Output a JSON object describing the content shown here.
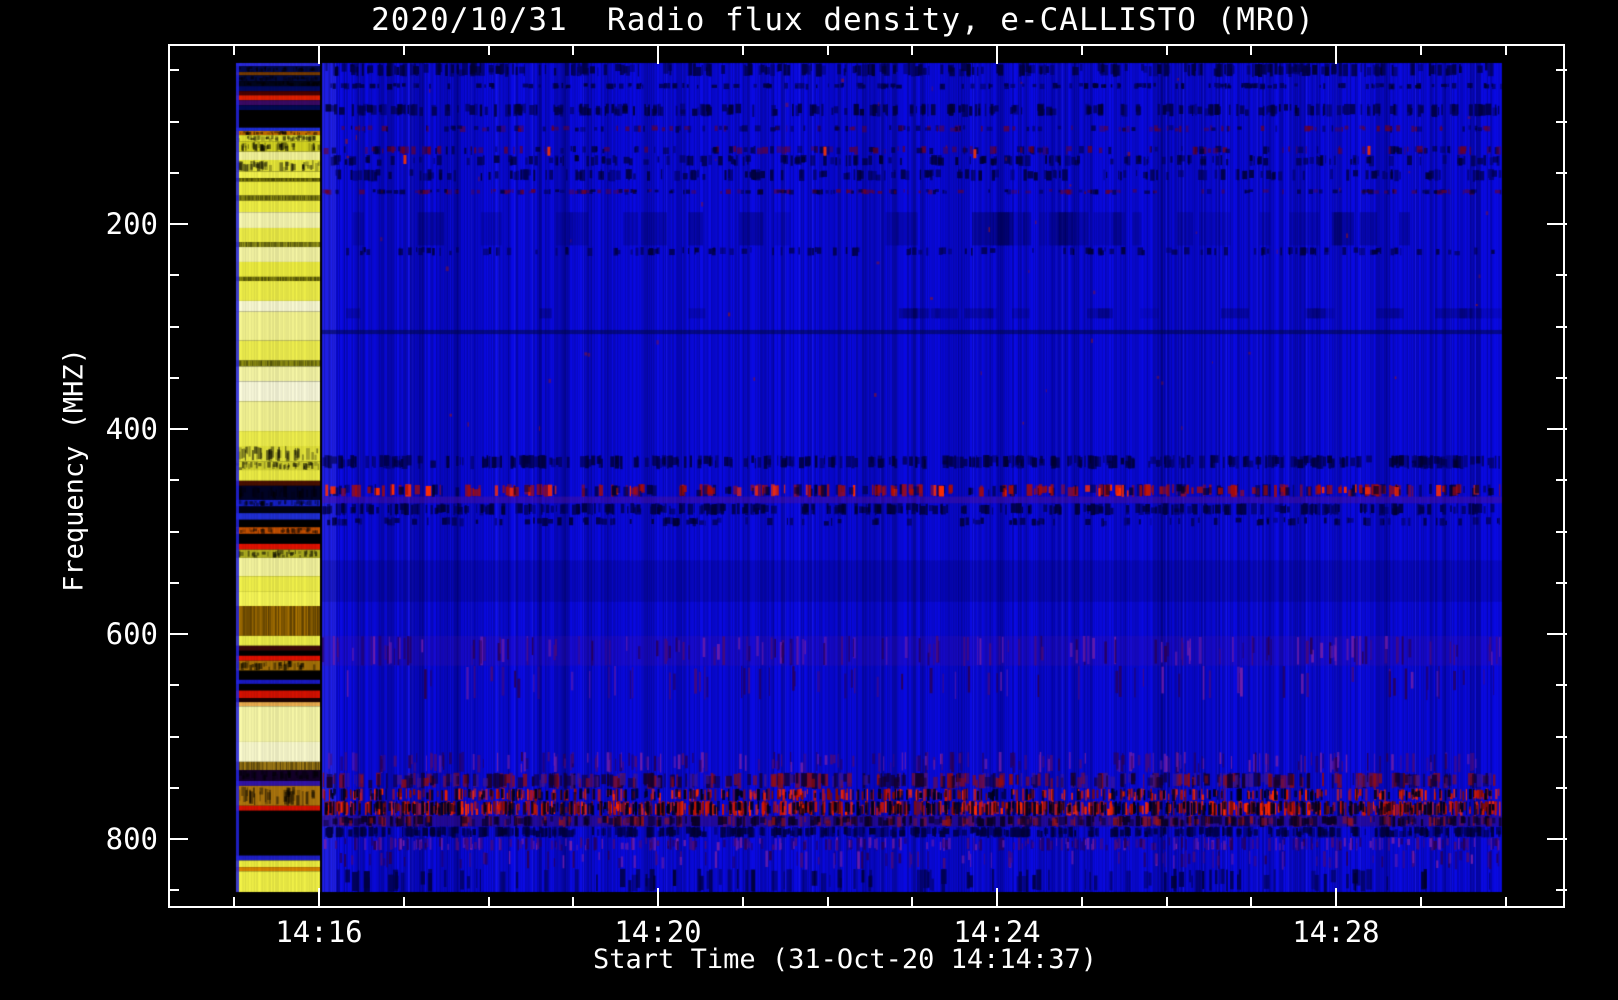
{
  "chart_data": {
    "type": "heatmap",
    "subtype": "radio-spectrogram",
    "title": "2020/10/31  Radio flux density, e-CALLISTO (MRO)",
    "xlabel": "Start Time (31-Oct-20 14:14:37)",
    "ylabel": "Frequency (MHZ)",
    "y_axis_direction": "frequency increases downward",
    "x_ticks": {
      "major": [
        {
          "minute": 16,
          "label": "14:16"
        },
        {
          "minute": 20,
          "label": "14:20"
        },
        {
          "minute": 24,
          "label": "14:24"
        },
        {
          "minute": 28,
          "label": "14:28"
        }
      ],
      "minor_minutes": [
        15,
        17,
        18,
        19,
        21,
        22,
        23,
        25,
        26,
        27,
        29,
        30
      ]
    },
    "y_ticks": {
      "major": [
        {
          "mhz": 200,
          "label": "200"
        },
        {
          "mhz": 400,
          "label": "400"
        },
        {
          "mhz": 600,
          "label": "600"
        },
        {
          "mhz": 800,
          "label": "800"
        }
      ],
      "minor_mhz": [
        50,
        100,
        150,
        250,
        300,
        350,
        450,
        500,
        550,
        650,
        700,
        750,
        850
      ]
    },
    "colors": {
      "background": "#000000",
      "axis": "#ffffff",
      "base_blue": "#0a0ae4",
      "bright_blue_edge": "rgba(90,90,255,0.28)",
      "red_burst": "#e61200",
      "yellow_calibration": "#f2f24a"
    },
    "spectrogram": {
      "description": "Mostly uniform saturated blue background with vertical noise striations; a bright yellow striped calibration column near 14:15-14:16; dark dashed interference rows near 45-90, 420-470 and 540-560 MHz; red RFI speckle row near 460-470 MHz; heavy red/purple RFI noise bands near 770-850 MHz; black no-data margins inside the frame.",
      "calibration_stripes": [
        [
          0.0,
          0.004,
          "#2a2ae0"
        ],
        [
          0.004,
          0.011,
          "#000a50",
          "speck"
        ],
        [
          0.011,
          0.015,
          "#7a3c00"
        ],
        [
          0.015,
          0.022,
          "#000a44",
          "speck"
        ],
        [
          0.022,
          0.028,
          "#00061e",
          "speck"
        ],
        [
          0.028,
          0.034,
          "#000a60"
        ],
        [
          0.034,
          0.039,
          "#4a0000"
        ],
        [
          0.039,
          0.045,
          "#e62000"
        ],
        [
          0.045,
          0.051,
          "#3c0a66"
        ],
        [
          0.051,
          0.057,
          "#000a55"
        ],
        [
          0.057,
          0.078,
          "#000000"
        ],
        [
          0.078,
          0.082,
          "#2030e0"
        ],
        [
          0.082,
          0.087,
          "#c87000",
          "speck"
        ],
        [
          0.087,
          0.095,
          "#e6e632",
          "speck"
        ],
        [
          0.095,
          0.107,
          "#d8d822",
          "speck"
        ],
        [
          0.107,
          0.117,
          "#f6f69a"
        ],
        [
          0.117,
          0.131,
          "#eded3a",
          "speck"
        ],
        [
          0.131,
          0.139,
          "#f6f64e"
        ],
        [
          0.139,
          0.143,
          "#8a8a06",
          "striate"
        ],
        [
          0.143,
          0.16,
          "#f0f040"
        ],
        [
          0.16,
          0.166,
          "#9a9a12",
          "striate"
        ],
        [
          0.166,
          0.18,
          "#f2f245"
        ],
        [
          0.18,
          0.199,
          "#fafab2"
        ],
        [
          0.199,
          0.216,
          "#f0f048"
        ],
        [
          0.216,
          0.222,
          "#a0a01a",
          "striate"
        ],
        [
          0.222,
          0.24,
          "#f8f8a6"
        ],
        [
          0.24,
          0.258,
          "#f0f040"
        ],
        [
          0.258,
          0.263,
          "#90900e",
          "striate"
        ],
        [
          0.263,
          0.287,
          "#f2f24a"
        ],
        [
          0.287,
          0.3,
          "#fdfdd6"
        ],
        [
          0.3,
          0.335,
          "#f8f892"
        ],
        [
          0.335,
          0.359,
          "#f2f250"
        ],
        [
          0.359,
          0.366,
          "#9a9a14",
          "striate"
        ],
        [
          0.366,
          0.384,
          "#fafaa8"
        ],
        [
          0.384,
          0.408,
          "#fdfdde"
        ],
        [
          0.408,
          0.444,
          "#f8f896"
        ],
        [
          0.444,
          0.462,
          "#f2f24e"
        ],
        [
          0.462,
          0.481,
          "#e8e83c",
          "speck"
        ],
        [
          0.481,
          0.491,
          "#d8d830",
          "speck"
        ],
        [
          0.491,
          0.504,
          "#f0f046"
        ],
        [
          0.504,
          0.51,
          "#4a1000"
        ],
        [
          0.51,
          0.527,
          "#000428",
          "speck"
        ],
        [
          0.527,
          0.535,
          "#1520c8",
          "speck"
        ],
        [
          0.535,
          0.543,
          "#000214"
        ],
        [
          0.543,
          0.551,
          "#2030d8"
        ],
        [
          0.551,
          0.56,
          "#000000"
        ],
        [
          0.56,
          0.568,
          "#c85200",
          "speck"
        ],
        [
          0.568,
          0.58,
          "#000000"
        ],
        [
          0.58,
          0.587,
          "#e61200"
        ],
        [
          0.587,
          0.597,
          "#b4b422",
          "speck"
        ],
        [
          0.597,
          0.619,
          "#f8f8a0"
        ],
        [
          0.619,
          0.638,
          "#f4f44c"
        ],
        [
          0.638,
          0.655,
          "#fafa58"
        ],
        [
          0.655,
          0.691,
          "#b07800",
          "striate"
        ],
        [
          0.691,
          0.703,
          "#f0f04a"
        ],
        [
          0.703,
          0.709,
          "#3c0808"
        ],
        [
          0.709,
          0.715,
          "#000000"
        ],
        [
          0.715,
          0.721,
          "#e61200"
        ],
        [
          0.721,
          0.733,
          "#a87408",
          "speck"
        ],
        [
          0.733,
          0.744,
          "#000000"
        ],
        [
          0.744,
          0.749,
          "#1a1ac8"
        ],
        [
          0.749,
          0.757,
          "#000000"
        ],
        [
          0.757,
          0.766,
          "#d81100"
        ],
        [
          0.766,
          0.771,
          "#1c0000"
        ],
        [
          0.771,
          0.776,
          "#f0b050"
        ],
        [
          0.776,
          0.819,
          "#fbfbaa"
        ],
        [
          0.819,
          0.843,
          "#fdfdd0"
        ],
        [
          0.843,
          0.853,
          "#b08818",
          "striate"
        ],
        [
          0.853,
          0.866,
          "#14002a",
          "speck"
        ],
        [
          0.866,
          0.872,
          "#3314aa"
        ],
        [
          0.872,
          0.896,
          "#b0780e",
          "speck"
        ],
        [
          0.896,
          0.902,
          "#d81100"
        ],
        [
          0.902,
          0.956,
          "#000000"
        ],
        [
          0.956,
          0.962,
          "#2020cc"
        ],
        [
          0.962,
          0.97,
          "#f0f040"
        ],
        [
          0.97,
          0.975,
          "#dd8800"
        ],
        [
          0.975,
          1.0,
          "#f5f548"
        ]
      ],
      "feature_bands": [
        [
          0.0,
          0.016,
          "darkdash",
          0.5
        ],
        [
          0.024,
          0.031,
          "darkdash",
          0.3
        ],
        [
          0.049,
          0.064,
          "darkdash",
          0.45
        ],
        [
          0.075,
          0.083,
          "darkreddash",
          0.25
        ],
        [
          0.1,
          0.11,
          "darkreddash",
          0.3
        ],
        [
          0.111,
          0.124,
          "darkdash",
          0.3
        ],
        [
          0.128,
          0.142,
          "darkdash",
          0.28
        ],
        [
          0.152,
          0.158,
          "darkreddash",
          0.35
        ],
        [
          0.18,
          0.22,
          "blotch",
          0.55
        ],
        [
          0.222,
          0.232,
          "darkdash",
          0.22
        ],
        [
          0.296,
          0.308,
          "blotch",
          0.4
        ],
        [
          0.322,
          0.327,
          "line",
          1.0
        ],
        [
          0.473,
          0.489,
          "darkdash",
          0.6
        ],
        [
          0.508,
          0.523,
          "reddash",
          0.55
        ],
        [
          0.523,
          0.531,
          "purpletint",
          0.45
        ],
        [
          0.531,
          0.545,
          "darkdash",
          0.55
        ],
        [
          0.548,
          0.558,
          "darkdash",
          0.22
        ],
        [
          0.6,
          0.65,
          "bluedeep",
          0.15
        ],
        [
          0.691,
          0.727,
          "purpletint",
          0.2
        ],
        [
          0.691,
          0.727,
          "purplestreak",
          0.22
        ],
        [
          0.727,
          0.768,
          "purplestreak",
          0.1
        ],
        [
          0.831,
          0.856,
          "purplestreak",
          0.3
        ],
        [
          0.856,
          0.875,
          "mixdash",
          0.6
        ],
        [
          0.875,
          0.89,
          "redstreak",
          0.4
        ],
        [
          0.89,
          0.908,
          "redstreak",
          0.85
        ],
        [
          0.908,
          0.921,
          "purpleheavy",
          0.75
        ],
        [
          0.921,
          0.934,
          "darkdash",
          0.8
        ],
        [
          0.934,
          0.95,
          "purplestreak",
          0.45
        ],
        [
          0.95,
          0.972,
          "purplestreak",
          0.15
        ],
        [
          0.972,
          1.0,
          "darkdash",
          0.2
        ]
      ],
      "bright_specks": [
        [
          0.069,
          0.111
        ],
        [
          0.191,
          0.101
        ],
        [
          0.425,
          0.101
        ],
        [
          0.552,
          0.104
        ],
        [
          0.886,
          0.1
        ]
      ]
    }
  }
}
